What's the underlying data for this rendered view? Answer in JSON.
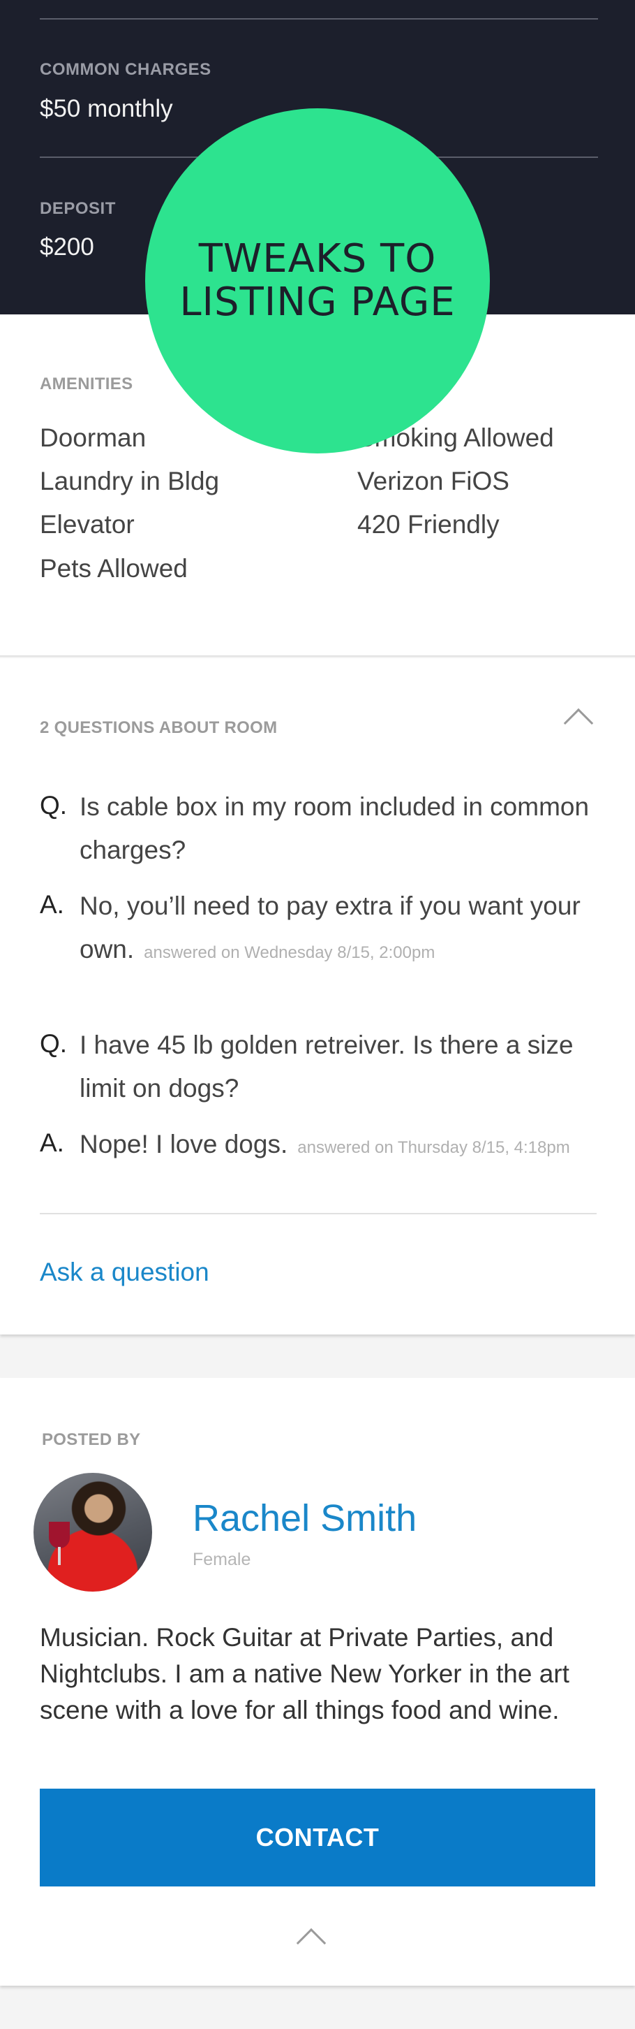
{
  "details": {
    "common_charges_label": "COMMON CHARGES",
    "common_charges_value": "$50 monthly",
    "deposit_label": "DEPOSIT",
    "deposit_value": "$200"
  },
  "overlay": {
    "line1": "TWEAKS TO",
    "line2": "LISTING PAGE"
  },
  "amenities": {
    "label": "AMENITIES",
    "left": [
      "Doorman",
      "Laundry in Bldg",
      "Elevator",
      "Pets Allowed"
    ],
    "right": [
      "Smoking Allowed",
      "Verizon FiOS",
      "420 Friendly"
    ]
  },
  "questions": {
    "header": "2 QUESTIONS ABOUT ROOM",
    "q_prefix": "Q.",
    "a_prefix": "A.",
    "items": [
      {
        "question": "Is cable box in my room included in common charges?",
        "answer": "No, you’ll need to pay extra if you want your own.",
        "answered": "answered on Wednesday 8/15, 2:00pm"
      },
      {
        "question": "I have 45 lb golden retreiver.  Is there a size limit on dogs?",
        "answer": "Nope!  I love dogs.",
        "answered": "answered on Thursday 8/15, 4:18pm"
      }
    ],
    "ask_link": "Ask a question",
    "collapse_icon": "chevron-up-icon"
  },
  "poster": {
    "label": "POSTED BY",
    "name": "Rachel Smith",
    "gender": "Female",
    "bio": "Musician. Rock Guitar at Private Parties, and Nightclubs.  I am a native New Yorker in the art scene with a love for all things food and wine.",
    "contact_label": "CONTACT",
    "scroll_top_icon": "chevron-up-icon"
  },
  "colors": {
    "header_bg": "#1c1f2c",
    "accent": "#1a87c9",
    "button": "#0a7bc8",
    "badge": "#2de38f"
  }
}
